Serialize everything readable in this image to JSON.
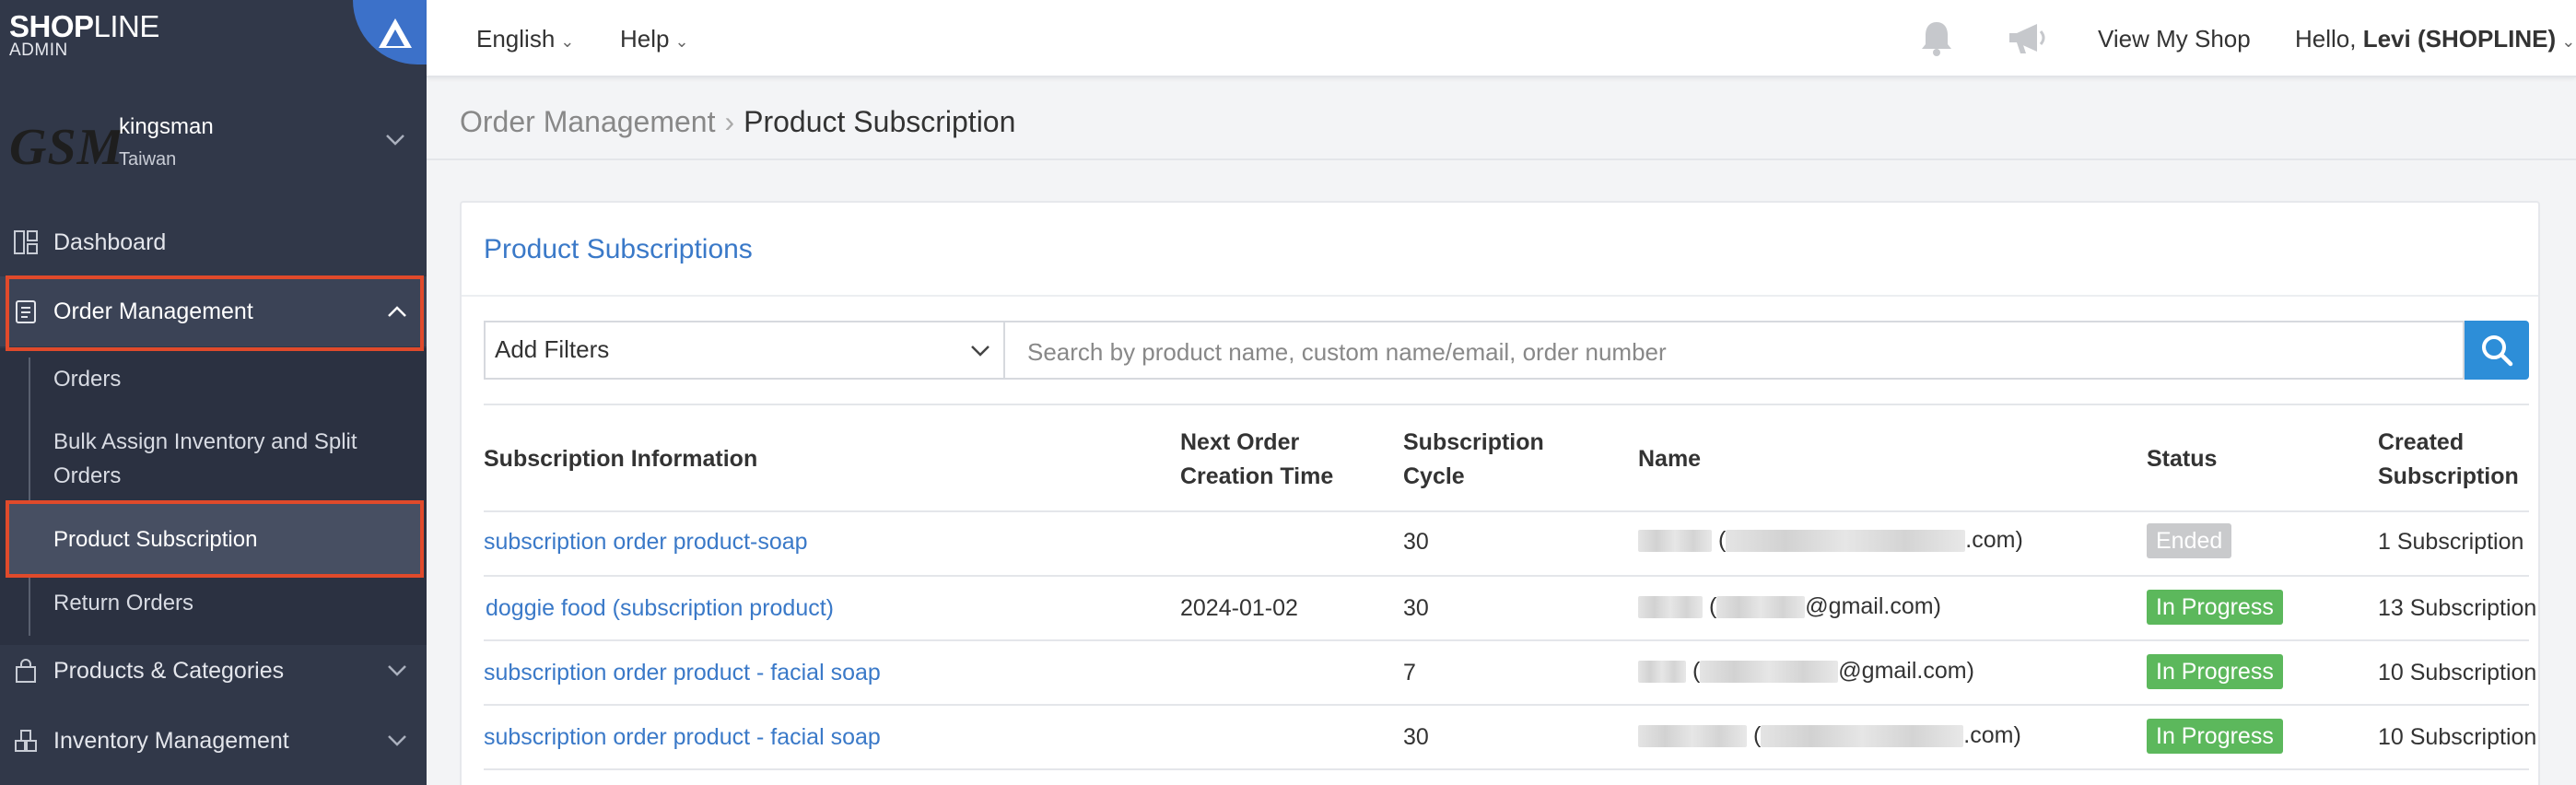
{
  "sidebar": {
    "logo_main_bold": "SHOP",
    "logo_main_thin": "LINE",
    "logo_sub": "ADMIN",
    "store_avatar": "GSM",
    "store_name": "kingsman",
    "store_region": "Taiwan",
    "dashboard": "Dashboard",
    "order_management": "Order Management",
    "sub_items": [
      "Orders",
      "Bulk Assign Inventory and Split",
      "Orders",
      "Product Subscription",
      "Return Orders"
    ],
    "products": "Products & Categories",
    "inventory": "Inventory Management"
  },
  "topbar": {
    "language": "English",
    "help": "Help",
    "view_shop": "View My Shop",
    "greeting": "Hello, ",
    "user": "Levi (SHOPLINE)"
  },
  "breadcrumb": {
    "parent": "Order Management",
    "current": "Product Subscription"
  },
  "panel": {
    "title": "Product Subscriptions",
    "filter_label": "Add Filters",
    "search_placeholder": "Search by product name, custom name/email, order number"
  },
  "table": {
    "headers": {
      "info": "Subscription Information",
      "next_1": "Next Order",
      "next_2": "Creation Time",
      "cycle_1": "Subscription",
      "cycle_2": "Cycle",
      "name": "Name",
      "status": "Status",
      "created_1": "Created",
      "created_2": "Subscription"
    },
    "rows": [
      {
        "product": "subscription order product-soap",
        "next": "",
        "cycle": "30",
        "email_suffix": ".com)",
        "status": "Ended",
        "created": "1 Subscription"
      },
      {
        "product": "doggie food (subscription product)",
        "next": "2024-01-02",
        "cycle": "30",
        "email_suffix": "@gmail.com)",
        "status": "In Progress",
        "created": "13 Subscription"
      },
      {
        "product": "subscription order product - facial soap",
        "next": "",
        "cycle": "7",
        "email_suffix": "@gmail.com)",
        "status": "In Progress",
        "created": "10 Subscription"
      },
      {
        "product": "subscription order product - facial soap",
        "next": "",
        "cycle": "30",
        "email_suffix": ".com)",
        "status": "In Progress",
        "created": "10 Subscription"
      }
    ],
    "open_paren": "("
  },
  "colors": {
    "sidebar_bg": "#313849",
    "accent_blue": "#3a79c8",
    "highlight": "#e04a2b",
    "status_progress": "#5cb85c",
    "status_ended": "#c9cacc"
  }
}
